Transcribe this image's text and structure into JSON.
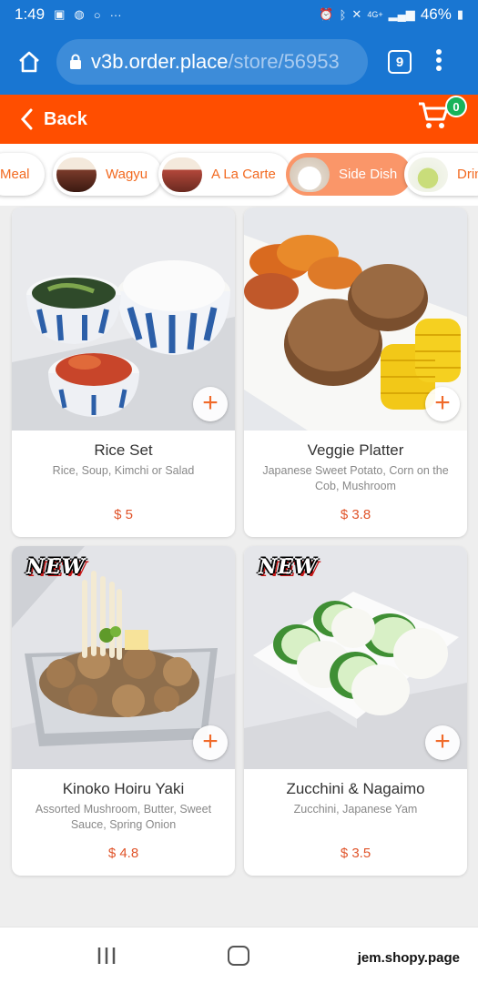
{
  "status_bar": {
    "time": "1:49",
    "battery": "46%",
    "network": "4G+"
  },
  "browser": {
    "url_host": "v3b.order.place",
    "url_path": "/store/56953",
    "tab_count": "9"
  },
  "header": {
    "back_label": "Back",
    "cart_count": "0"
  },
  "categories": [
    {
      "label": "Meal",
      "active": false
    },
    {
      "label": "Wagyu",
      "active": false
    },
    {
      "label": "A La Carte",
      "active": false
    },
    {
      "label": "Side Dish",
      "active": true
    },
    {
      "label": "Drin",
      "active": false
    }
  ],
  "products": [
    {
      "name": "Rice Set",
      "desc": "Rice, Soup, Kimchi or Salad",
      "price": "$ 5",
      "is_new": false
    },
    {
      "name": "Veggie Platter",
      "desc": "Japanese Sweet Potato, Corn on the Cob, Mushroom",
      "price": "$ 3.8",
      "is_new": false
    },
    {
      "name": "Kinoko Hoiru Yaki",
      "desc": "Assorted Mushroom, Butter, Sweet Sauce, Spring Onion",
      "price": "$ 4.8",
      "is_new": true
    },
    {
      "name": "Zucchini & Nagaimo",
      "desc": "Zucchini, Japanese Yam",
      "price": "$ 3.5",
      "is_new": true
    }
  ],
  "new_tag": "NEW",
  "watermark": "jem.shopy.page",
  "colors": {
    "browser_blue": "#1976d2",
    "header_orange": "#ff4e00",
    "active_chip": "#fa9669",
    "price": "#e0542a",
    "badge_green": "#19b35a"
  }
}
